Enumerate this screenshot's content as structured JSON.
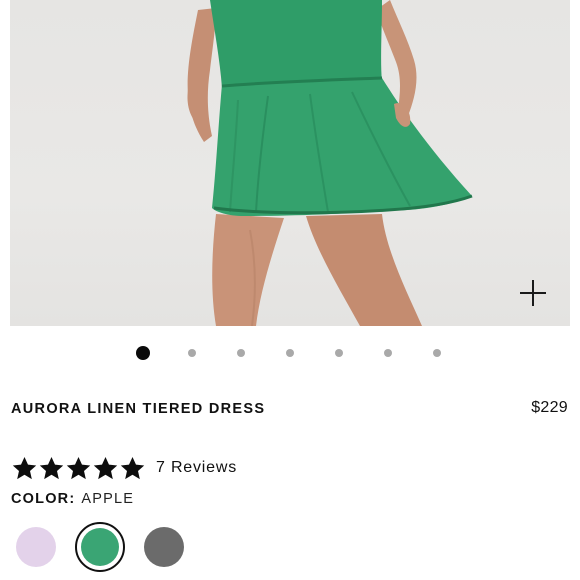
{
  "gallery": {
    "image_alt": "Model wearing a green linen tiered dress",
    "zoom_icon": "plus-icon",
    "dots": [
      {
        "active": true
      },
      {
        "active": false
      },
      {
        "active": false
      },
      {
        "active": false
      },
      {
        "active": false
      },
      {
        "active": false
      },
      {
        "active": false
      }
    ]
  },
  "product": {
    "title": "AURORA LINEN TIERED DRESS",
    "price": "$229"
  },
  "rating": {
    "stars": 5,
    "reviews_label": "7 Reviews"
  },
  "color": {
    "label": "COLOR:",
    "value": "APPLE",
    "swatches": [
      {
        "hex": "#e3d2ea",
        "selected": false
      },
      {
        "hex": "#3aa574",
        "selected": true
      },
      {
        "hex": "#6b6b6b",
        "selected": false
      }
    ]
  },
  "colors": {
    "dress_green": "#2e9a66",
    "text": "#111111",
    "dot_inactive": "#a9a9a9"
  }
}
